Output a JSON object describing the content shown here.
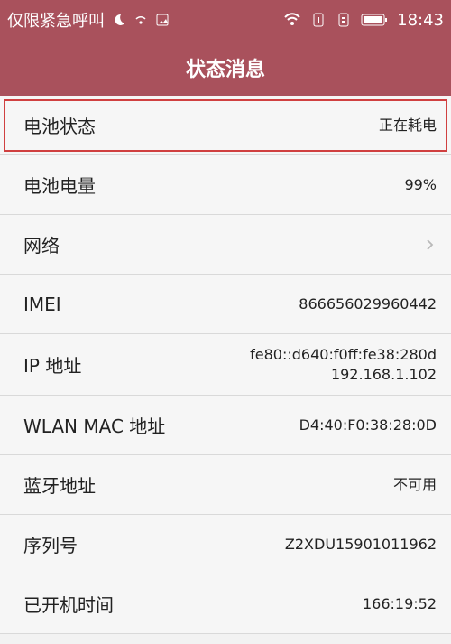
{
  "status_bar": {
    "left_text": "仅限紧急呼叫",
    "time": "18:43"
  },
  "header": {
    "title": "状态消息"
  },
  "rows": [
    {
      "label": "电池状态",
      "value": "正在耗电"
    },
    {
      "label": "电池电量",
      "value": "99%"
    },
    {
      "label": "网络",
      "value": ""
    },
    {
      "label": "IMEI",
      "value": "866656029960442"
    },
    {
      "label": "IP 地址",
      "value_line1": "fe80::d640:f0ff:fe38:280d",
      "value_line2": "192.168.1.102"
    },
    {
      "label": "WLAN MAC 地址",
      "value": "D4:40:F0:38:28:0D"
    },
    {
      "label": "蓝牙地址",
      "value": "不可用"
    },
    {
      "label": "序列号",
      "value": "Z2XDU15901011962"
    },
    {
      "label": "已开机时间",
      "value": "166:19:52"
    }
  ],
  "colors": {
    "brand": "#a9515c",
    "highlight": "#d04040"
  },
  "icons": [
    "moon-icon",
    "wifi-weak-icon",
    "image-icon",
    "wifi-icon",
    "sim1-icon",
    "sim2-icon",
    "battery-icon",
    "chevron-right-icon"
  ]
}
